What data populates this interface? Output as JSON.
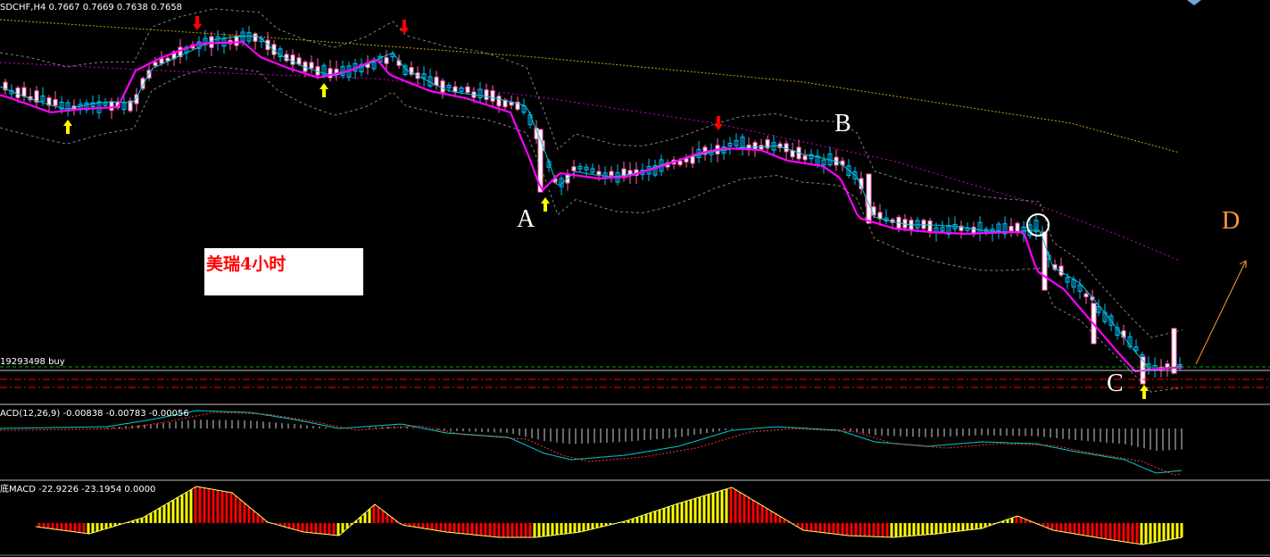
{
  "header": {
    "symbol_info": "SDCHF,H4  0.7667 0.7669 0.7638 0.7658"
  },
  "annotations": {
    "point_a": "A",
    "point_b": "B",
    "point_c": "C",
    "point_d": "D",
    "note_box": "美瑞4小时"
  },
  "order_line_label": "19293498 buy",
  "indicators": {
    "macd_label": "ACD(12,26,9) -0.00838 -0.00783 -0.00056",
    "bottom_label": "底MACD -22.9226 -23.1954 0.0000"
  },
  "colors": {
    "background": "#000000",
    "candle_up": "#00bfff",
    "candle_down": "#ff69b4",
    "ma_fast": "#00ced1",
    "ma_mid": "#ff00ff",
    "ma_slow_dotted": "#cc00cc",
    "ma_long": "#c8a000",
    "bollinger": "#808080",
    "arrow_sell": "#ff0000",
    "arrow_buy": "#ffff00",
    "order_line": "#00aa00",
    "stop_lines": "#ff0000",
    "macd_line": "#00ced1",
    "signal_line": "#ff3333",
    "hist_up": "#ffff00",
    "hist_down": "#ff0000"
  },
  "chart_data": {
    "type": "candlestick",
    "title": "SDCHF,H4",
    "ohlc_last": {
      "open": 0.7667,
      "high": 0.7669,
      "low": 0.7638,
      "close": 0.7658
    },
    "close_path": [
      0.77,
      0.7692,
      0.7688,
      0.7684,
      0.7676,
      0.769,
      0.769,
      0.7722,
      0.774,
      0.7736,
      0.7743,
      0.7742,
      0.7741,
      0.7744,
      0.773,
      0.772,
      0.7715,
      0.7718,
      0.7714,
      0.7724,
      0.7732,
      0.7738,
      0.772,
      0.7712,
      0.7714,
      0.7703,
      0.7706,
      0.7698,
      0.7687,
      0.7663,
      0.7648,
      0.766,
      0.7658,
      0.7662,
      0.766,
      0.7662,
      0.767,
      0.7674,
      0.768,
      0.7677,
      0.7677,
      0.7674,
      0.766,
      0.7658,
      0.765,
      0.7636,
      0.7628,
      0.7628,
      0.7627,
      0.7626,
      0.7625,
      0.7626,
      0.7608,
      0.7592,
      0.7574,
      0.756,
      0.7545,
      0.7562,
      0.758
    ],
    "sell_arrows": 4,
    "buy_arrows": 5,
    "macd": {
      "name": "ACD(12,26,9)",
      "main": -0.00838,
      "signal": -0.00783,
      "hist": -0.00056
    },
    "bottom_macd": {
      "name": "底MACD",
      "v1": -22.9226,
      "v2": -23.1954,
      "v3": 0.0
    }
  }
}
